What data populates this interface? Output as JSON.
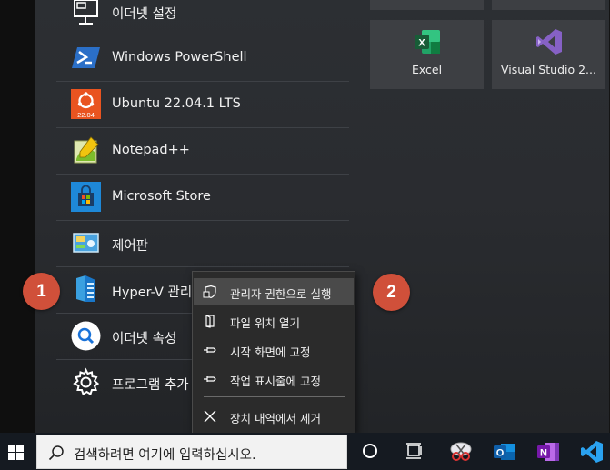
{
  "app_list": [
    {
      "label": "이더넷 설정",
      "icon": "ethernet-settings-icon"
    },
    {
      "label": "Windows PowerShell",
      "icon": "powershell-icon"
    },
    {
      "label": "Ubuntu 22.04.1 LTS",
      "icon": "ubuntu-icon",
      "icon_text": "22.04"
    },
    {
      "label": "Notepad++",
      "icon": "notepad-plus-plus-icon"
    },
    {
      "label": "Microsoft Store",
      "icon": "microsoft-store-icon"
    },
    {
      "label": "제어판",
      "icon": "control-panel-icon"
    },
    {
      "label": "Hyper-V 관리",
      "icon": "hyper-v-icon"
    },
    {
      "label": "이더넷 속성",
      "icon": "network-search-icon"
    },
    {
      "label": "프로그램 추가",
      "icon": "gear-icon"
    }
  ],
  "tiles": [
    {
      "label": "Excel",
      "icon": "excel-icon",
      "icon_text": "X"
    },
    {
      "label": "Visual Studio 2...",
      "icon": "visual-studio-icon"
    }
  ],
  "context_menu": [
    {
      "label": "관리자 권한으로 실행",
      "icon": "shield-icon",
      "hover": true
    },
    {
      "label": "파일 위치 열기",
      "icon": "folder-icon"
    },
    {
      "label": "시작 화면에 고정",
      "icon": "pin-icon"
    },
    {
      "label": "작업 표시줄에 고정",
      "icon": "pin-icon"
    },
    {
      "label": "장치 내역에서 제거",
      "icon": "close-icon"
    }
  ],
  "badges": [
    "1",
    "2"
  ],
  "colors": {
    "badge": "#d0503a",
    "accent": "#0078d7"
  },
  "taskbar": {
    "search_placeholder": "검색하려면 여기에 입력하십시오.",
    "icons": [
      "windows-start-icon",
      "cortana-circle-icon",
      "task-view-icon",
      "snipping-tool-icon",
      "outlook-icon",
      "onenote-icon",
      "vscode-icon"
    ],
    "outlook_letter": "O",
    "onenote_letter": "N"
  }
}
